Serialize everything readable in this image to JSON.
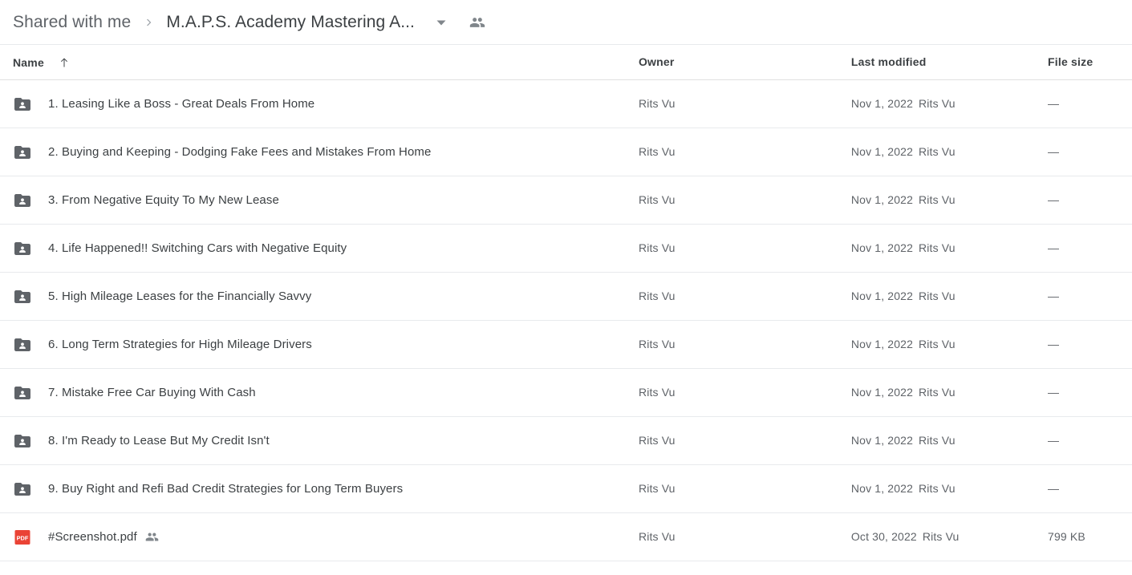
{
  "breadcrumb": {
    "parent": "Shared with me",
    "separator_icon": "chevron-right-icon",
    "current": "M.A.P.S. Academy Mastering A...",
    "caret_icon": "chevron-down-icon",
    "people_icon": "people-shared-icon"
  },
  "columns": {
    "name": "Name",
    "sort_icon": "arrow-up-icon",
    "owner": "Owner",
    "last_modified": "Last modified",
    "file_size": "File size"
  },
  "colors": {
    "folder_icon": "#5f6368",
    "pdf_icon": "#ea4335",
    "text_primary": "#3c4043",
    "text_secondary": "#5f6368",
    "divider": "#e8eaed"
  },
  "rows": [
    {
      "icon": "shared-folder-icon",
      "name": "1. Leasing Like a Boss - Great Deals From Home",
      "shared": false,
      "owner": "Rits Vu",
      "modified_date": "Nov 1, 2022",
      "modified_by": "Rits Vu",
      "size": "—"
    },
    {
      "icon": "shared-folder-icon",
      "name": "2. Buying and Keeping - Dodging Fake Fees and Mistakes From Home",
      "shared": false,
      "owner": "Rits Vu",
      "modified_date": "Nov 1, 2022",
      "modified_by": "Rits Vu",
      "size": "—"
    },
    {
      "icon": "shared-folder-icon",
      "name": "3. From Negative Equity To My New Lease",
      "shared": false,
      "owner": "Rits Vu",
      "modified_date": "Nov 1, 2022",
      "modified_by": "Rits Vu",
      "size": "—"
    },
    {
      "icon": "shared-folder-icon",
      "name": "4. Life Happened!! Switching Cars with Negative Equity",
      "shared": false,
      "owner": "Rits Vu",
      "modified_date": "Nov 1, 2022",
      "modified_by": "Rits Vu",
      "size": "—"
    },
    {
      "icon": "shared-folder-icon",
      "name": "5. High Mileage Leases for the Financially Savvy",
      "shared": false,
      "owner": "Rits Vu",
      "modified_date": "Nov 1, 2022",
      "modified_by": "Rits Vu",
      "size": "—"
    },
    {
      "icon": "shared-folder-icon",
      "name": "6. Long Term Strategies for High Mileage Drivers",
      "shared": false,
      "owner": "Rits Vu",
      "modified_date": "Nov 1, 2022",
      "modified_by": "Rits Vu",
      "size": "—"
    },
    {
      "icon": "shared-folder-icon",
      "name": "7. Mistake Free Car Buying With Cash",
      "shared": false,
      "owner": "Rits Vu",
      "modified_date": "Nov 1, 2022",
      "modified_by": "Rits Vu",
      "size": "—"
    },
    {
      "icon": "shared-folder-icon",
      "name": "8. I'm Ready to Lease But My Credit Isn't",
      "shared": false,
      "owner": "Rits Vu",
      "modified_date": "Nov 1, 2022",
      "modified_by": "Rits Vu",
      "size": "—"
    },
    {
      "icon": "shared-folder-icon",
      "name": "9. Buy Right and Refi Bad Credit Strategies for Long Term Buyers",
      "shared": false,
      "owner": "Rits Vu",
      "modified_date": "Nov 1, 2022",
      "modified_by": "Rits Vu",
      "size": "—"
    },
    {
      "icon": "pdf-file-icon",
      "name": "#Screenshot.pdf",
      "shared": true,
      "owner": "Rits Vu",
      "modified_date": "Oct 30, 2022",
      "modified_by": "Rits Vu",
      "size": "799 KB"
    }
  ]
}
